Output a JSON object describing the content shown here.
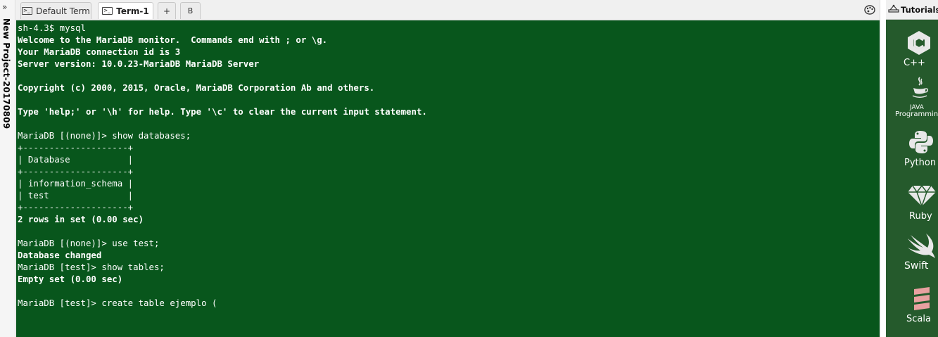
{
  "sidebar": {
    "chevron": "»",
    "project_name": "New Project-20170809"
  },
  "tabs": [
    {
      "label": "Default Term",
      "active": false
    },
    {
      "label": "Term-1",
      "active": true
    },
    {
      "label": "+",
      "active": false
    },
    {
      "label": "B",
      "active": false
    }
  ],
  "settings_icon": "palette-icon",
  "terminal": {
    "background": "#08561c",
    "lines": [
      {
        "text": "sh-4.3$ mysql",
        "bold": false
      },
      {
        "text": "Welcome to the MariaDB monitor.  Commands end with ; or \\g.",
        "bold": true
      },
      {
        "text": "Your MariaDB connection id is 3",
        "bold": true
      },
      {
        "text": "Server version: 10.0.23-MariaDB MariaDB Server",
        "bold": true
      },
      {
        "text": "",
        "bold": false
      },
      {
        "text": "Copyright (c) 2000, 2015, Oracle, MariaDB Corporation Ab and others.",
        "bold": true
      },
      {
        "text": "",
        "bold": false
      },
      {
        "text": "Type 'help;' or '\\h' for help. Type '\\c' to clear the current input statement.",
        "bold": true
      },
      {
        "text": "",
        "bold": false
      },
      {
        "text": "MariaDB [(none)]> show databases;",
        "bold": false
      },
      {
        "text": "+--------------------+",
        "bold": false
      },
      {
        "text": "| Database           |",
        "bold": false
      },
      {
        "text": "+--------------------+",
        "bold": false
      },
      {
        "text": "| information_schema |",
        "bold": false
      },
      {
        "text": "| test               |",
        "bold": false
      },
      {
        "text": "+--------------------+",
        "bold": false
      },
      {
        "text": "2 rows in set (0.00 sec)",
        "bold": true
      },
      {
        "text": "",
        "bold": false
      },
      {
        "text": "MariaDB [(none)]> use test;",
        "bold": false
      },
      {
        "text": "Database changed",
        "bold": true
      },
      {
        "text": "MariaDB [test]> show tables;",
        "bold": false
      },
      {
        "text": "Empty set (0.00 sec)",
        "bold": true
      },
      {
        "text": "",
        "bold": false
      },
      {
        "text": "MariaDB [test]> create table ejemplo (",
        "bold": false
      }
    ]
  },
  "tutorials": {
    "label": "Tutorials",
    "icon": "tutorials-icon",
    "languages": [
      {
        "label": "C++",
        "icon": "cpp-icon"
      },
      {
        "label": "JAVA",
        "sublabel": "Programming",
        "icon": "java-icon"
      },
      {
        "label": "Python",
        "icon": "python-icon"
      },
      {
        "label": "Ruby",
        "icon": "ruby-icon"
      },
      {
        "label": "Swift",
        "icon": "swift-icon"
      },
      {
        "label": "Scala",
        "icon": "scala-icon"
      }
    ]
  }
}
